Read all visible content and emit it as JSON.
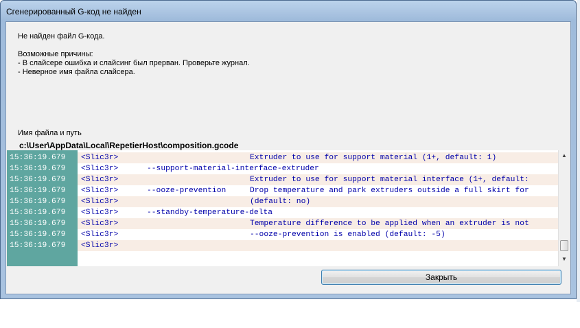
{
  "window": {
    "title": "Сгенерированный G-код не найден"
  },
  "message": {
    "line1": "Не найден файл G-кода.",
    "line2": "Возможные причины:",
    "line3": "- В слайсере ошибка и слайсинг был прерван. Проверьте журнал.",
    "line4": "- Неверное имя файла слайсера."
  },
  "path": {
    "label": "Имя файла и путь",
    "value": "c:\\User\\AppData\\Local\\RepetierHost\\composition.gcode"
  },
  "log": {
    "rows": [
      {
        "ts": "15:36:19.679",
        "tag": "<Slic3r>",
        "opt": "",
        "desc": "Extruder to use for support material (1+, default: 1)"
      },
      {
        "ts": "15:36:19.679",
        "tag": "<Slic3r>",
        "opt": "--support-material-interface-extruder",
        "desc": ""
      },
      {
        "ts": "15:36:19.679",
        "tag": "<Slic3r>",
        "opt": "",
        "desc": "Extruder to use for support material interface (1+, default:"
      },
      {
        "ts": "15:36:19.679",
        "tag": "<Slic3r>",
        "opt": "--ooze-prevention",
        "desc": "Drop temperature and park extruders outside a full skirt for"
      },
      {
        "ts": "15:36:19.679",
        "tag": "<Slic3r>",
        "opt": "",
        "desc": "(default: no)"
      },
      {
        "ts": "15:36:19.679",
        "tag": "<Slic3r>",
        "opt": "--standby-temperature-delta",
        "desc": ""
      },
      {
        "ts": "15:36:19.679",
        "tag": "<Slic3r>",
        "opt": "",
        "desc": "Temperature difference to be applied when an extruder is not"
      },
      {
        "ts": "15:36:19.679",
        "tag": "<Slic3r>",
        "opt": "",
        "desc": "--ooze-prevention is enabled (default: -5)"
      },
      {
        "ts": "15:36:19.679",
        "tag": "<Slic3r>",
        "opt": "",
        "desc": ""
      }
    ]
  },
  "buttons": {
    "close_label": "Закрыть"
  },
  "colors": {
    "timestamp_bg": "#5fa6a0",
    "row_alt_bg": "#f8ede5",
    "log_text": "#0000aa"
  },
  "icons": {
    "scroll_up": "▲",
    "scroll_down": "▼"
  }
}
